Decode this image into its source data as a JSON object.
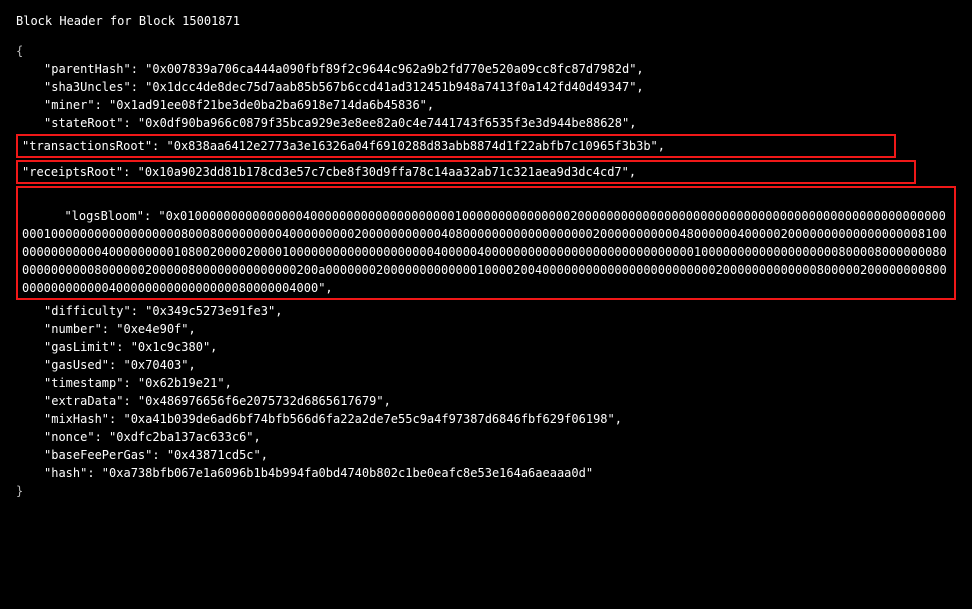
{
  "title": "Block Header for Block 15001871",
  "keys": {
    "parentHash": "\"parentHash\"",
    "sha3Uncles": "\"sha3Uncles\"",
    "miner": "\"miner\"",
    "stateRoot": "\"stateRoot\"",
    "transactionsRoot": "\"transactionsRoot\"",
    "receiptsRoot": "\"receiptsRoot\"",
    "logsBloom": "\"logsBloom\"",
    "difficulty": "\"difficulty\"",
    "number": "\"number\"",
    "gasLimit": "\"gasLimit\"",
    "gasUsed": "\"gasUsed\"",
    "timestamp": "\"timestamp\"",
    "extraData": "\"extraData\"",
    "mixHash": "\"mixHash\"",
    "nonce": "\"nonce\"",
    "baseFeePerGas": "\"baseFeePerGas\"",
    "hash": "\"hash\""
  },
  "values": {
    "parentHash": ": \"0x007839a706ca444a090fbf89f2c9644c962a9b2fd770e520a09cc8fc87d7982d\",",
    "sha3Uncles": ": \"0x1dcc4de8dec75d7aab85b567b6ccd41ad312451b948a7413f0a142fd40d49347\",",
    "miner": ": \"0x1ad91ee08f21be3de0ba2ba6918e714da6b45836\",",
    "stateRoot": ": \"0x0df90ba966c0879f35bca929e3e8ee82a0c4e7441743f6535f3e3d944be88628\",",
    "transactionsRoot": ": \"0x838aa6412e2773a3e16326a04f6910288d83abb8874d1f22abfb7c10965f3b3b\",",
    "receiptsRoot": ": \"0x10a9023dd81b178cd3e57c7cbe8f30d9ffa78c14aa32ab71c321aea9d3dc4cd7\",",
    "logsBloom": ": \"0x0100000000000000040000000000000000000010000000000000002000000000000000000000000000000000000000000000000000000100000000000000000080008000000000400000000020000000000040800000000000000000020000000000048000000400000200000000000000000081000000000000040000000001080020000200001000000000000000000004000004000000000000000000000000000001000000000000000000080000800000008000000000008000000200000800000000000000200a0000000200000000000001000020040000000000000000000000002000000000000080000020000000080000000000000040000000000000000080000004000\",",
    "difficulty": ": \"0x349c5273e91fe3\",",
    "number": ": \"0xe4e90f\",",
    "gasLimit": ": \"0x1c9c380\",",
    "gasUsed": ": \"0x70403\",",
    "timestamp": ": \"0x62b19e21\",",
    "extraData": ": \"0x486976656f6e2075732d6865617679\",",
    "mixHash": ": \"0xa41b039de6ad6bf74bfb566d6fa22a2de7e55c9a4f97387d6846fbf629f06198\",",
    "nonce": ": \"0xdfc2ba137ac633c6\",",
    "baseFeePerGas": ": \"0x43871cd5c\",",
    "hash": ": \"0xa738bfb067e1a6096b1b4b994fa0bd4740b802c1be0eafc8e53e164a6aeaaa0d\""
  },
  "punct": {
    "openBrace": "{",
    "closeBrace": "}"
  }
}
